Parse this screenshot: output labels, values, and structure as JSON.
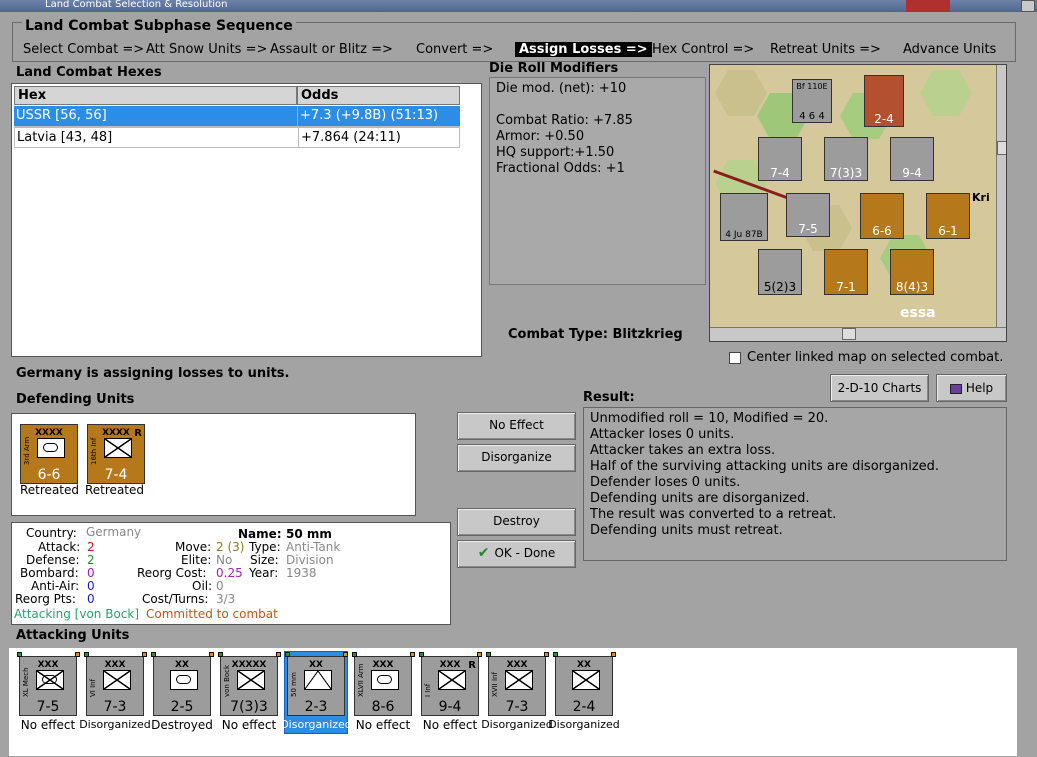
{
  "window": {
    "title": "Land Combat Selection & Resolution"
  },
  "sequence": {
    "title": "Land Combat Subphase Sequence",
    "steps": [
      "Select Combat =>",
      "Att Snow Units =>",
      "Assault or Blitz =>",
      "Convert =>",
      "Assign Losses =>",
      "Hex Control =>",
      "Retreat Units =>",
      "Advance Units"
    ],
    "active_index": 4
  },
  "hexes": {
    "title": "Land Combat Hexes",
    "columns": [
      "Hex",
      "Odds"
    ],
    "rows": [
      {
        "hex": "USSR [56, 56]",
        "odds": "+7.3 (+9.8B) (51:13)",
        "selected": true
      },
      {
        "hex": "Latvia [43, 48]",
        "odds": "+7.864 (24:11)",
        "selected": false
      }
    ]
  },
  "modifiers": {
    "title": "Die Roll Modifiers",
    "lines": [
      "Die mod. (net): +10",
      "",
      "Combat Ratio: +7.85",
      "Armor: +0.50",
      "HQ support:+1.50",
      "Fractional Odds: +1"
    ]
  },
  "combat_type": "Combat Type:  Blitzkrieg",
  "center_map": {
    "label": "Center linked map on selected combat.",
    "checked": false
  },
  "map": {
    "label_essa": "essa",
    "label_kri": "Kri"
  },
  "status": "Germany is assigning losses to units.",
  "buttons": {
    "charts": "2-D-10 Charts",
    "help": "Help",
    "no_effect": "No Effect",
    "disorganize": "Disorganize",
    "destroy": "Destroy",
    "ok": "OK - Done"
  },
  "defending": {
    "title": "Defending Units",
    "units": [
      {
        "name": "3rd Arm",
        "size": "XXXX",
        "values": "6-6",
        "status": "Retreated",
        "symbol": "armor"
      },
      {
        "name": "16th Inf",
        "size": "XXXX",
        "values": "7-4",
        "status": "Retreated",
        "symbol": "infantry",
        "tag": "R"
      }
    ]
  },
  "result": {
    "title": "Result:",
    "lines": [
      "Unmodified roll = 10, Modified = 20.",
      "Attacker loses 0 units.",
      "Attacker takes an extra loss.",
      "Half of the surviving attacking units are disorganized.",
      "Defender loses 0 units.",
      "Defending units are disorganized.",
      "The result was converted to a retreat.",
      "Defending units must retreat."
    ]
  },
  "info": {
    "country_label": "Country:",
    "country": "Germany",
    "name_label": "Name:",
    "name": "50 mm",
    "attack_label": "Attack:",
    "attack": "2",
    "defense_label": "Defense:",
    "defense": "2",
    "bombard_label": "Bombard:",
    "bombard": "0",
    "antiair_label": "Anti-Air:",
    "antiair": "0",
    "reorgpts_label": "Reorg Pts:",
    "reorgpts": "0",
    "move_label": "Move:",
    "move": "2 (3)",
    "elite_label": "Elite:",
    "elite": "No",
    "reorgcost_label": "Reorg Cost:",
    "reorgcost": "0.25",
    "oil_label": "Oil:",
    "oil": "0",
    "costturns_label": "Cost/Turns:",
    "costturns": "3/3",
    "type_label": "Type:",
    "type": "Anti-Tank",
    "size_label": "Size:",
    "size": "Division",
    "year_label": "Year:",
    "year": "1938",
    "attacking": "Attacking [von Bock]",
    "committed": "Committed to combat"
  },
  "attacking": {
    "title": "Attacking Units",
    "units": [
      {
        "name": "XL Mech",
        "size": "XXX",
        "values": "7-5",
        "status": "No effect",
        "symbol": "mech"
      },
      {
        "name": "VI Inf",
        "size": "XXX",
        "values": "7-3",
        "status": "Disorganized",
        "symbol": "infantry"
      },
      {
        "name": "",
        "size": "XX",
        "values": "2-5",
        "status": "Destroyed",
        "symbol": "armor"
      },
      {
        "name": "von Bock",
        "size": "XXXXX",
        "values": "7(3)3",
        "status": "No effect",
        "symbol": "infantry"
      },
      {
        "name": "50 mm",
        "size": "XX",
        "values": "2-3",
        "status": "Disorganized",
        "symbol": "antitank",
        "selected": true
      },
      {
        "name": "XLVII Arm",
        "size": "XXX",
        "values": "8-6",
        "status": "No effect",
        "symbol": "armor"
      },
      {
        "name": "I Inf",
        "size": "XXX",
        "values": "9-4",
        "status": "No effect",
        "symbol": "infantry",
        "tag": "R"
      },
      {
        "name": "XVII Inf",
        "size": "XXX",
        "values": "7-3",
        "status": "Disorganized",
        "symbol": "infantry"
      },
      {
        "name": "",
        "size": "XX",
        "values": "2-4",
        "status": "Disorganized",
        "symbol": "infantry"
      }
    ]
  },
  "colors": {
    "accent": "#2b8de6",
    "german_counter": "#9c9c9c",
    "soviet_counter": "#b5781b",
    "attacking_text": "#2aa06a",
    "committed_text": "#c0551a"
  }
}
